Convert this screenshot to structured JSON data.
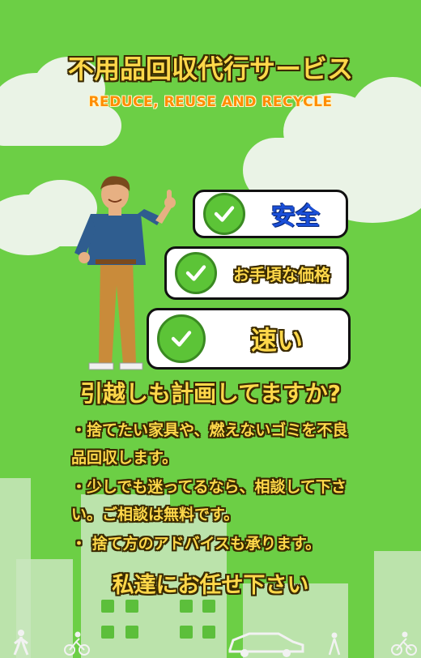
{
  "header": {
    "title": "不用品回収代行サービス",
    "subtitle": "REDUCE, REUSE AND RECYCLE"
  },
  "badges": [
    {
      "label": "安全",
      "icon": "check-icon"
    },
    {
      "label": "お手頃な価格",
      "icon": "check-icon"
    },
    {
      "label": "速い",
      "icon": "check-icon"
    }
  ],
  "question": "引越しも計画してますか?",
  "body": {
    "line1": "・捨てたい家具や、燃えないゴミを不良品回収します。",
    "line2": "・少しでも迷ってるなら、相談して下さい。ご相談は無料です。",
    "line3": "・ 捨て方のアドバイスも承ります。"
  },
  "cta": "私達にお任せ下さい",
  "colors": {
    "background": "#6ccf45",
    "accent": "#ffd84a",
    "subtitle": "#ff8c00",
    "check": "#5cc437",
    "badge_text_1": "#1a4fd8"
  }
}
